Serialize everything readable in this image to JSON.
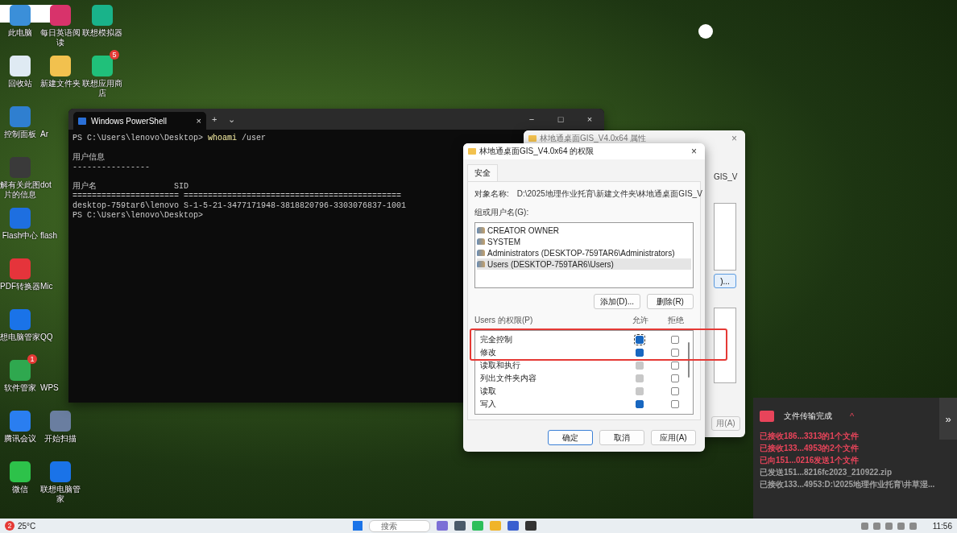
{
  "desktop_icons": [
    {
      "label": "此电脑",
      "kind": "app"
    },
    {
      "label": "回收站",
      "kind": "app"
    },
    {
      "label": "控制面板",
      "kind": "app"
    },
    {
      "label": "解有关此图片的信息",
      "kind": "app"
    },
    {
      "label": "Flash中心",
      "kind": "app"
    },
    {
      "label": "PDF转换器",
      "kind": "app"
    },
    {
      "label": "想电脑管家",
      "kind": "app"
    },
    {
      "label": "软件管家",
      "kind": "app",
      "badge": "1"
    },
    {
      "label": "腾讯会议",
      "kind": "app"
    },
    {
      "label": "微信",
      "kind": "app"
    },
    {
      "label": "每日英语阅读",
      "kind": "app"
    },
    {
      "label": "新建文件夹",
      "kind": "app"
    },
    {
      "label": "Ar",
      "kind": "covered"
    },
    {
      "label": "dot",
      "kind": "covered"
    },
    {
      "label": "flash",
      "kind": "covered"
    },
    {
      "label": "Mic",
      "kind": "covered"
    },
    {
      "label": "QQ",
      "kind": "covered"
    },
    {
      "label": "WPS",
      "kind": "covered"
    },
    {
      "label": "开始扫描",
      "kind": "app"
    },
    {
      "label": "联想电脑管家",
      "kind": "app"
    },
    {
      "label": "联想模拟器",
      "kind": "app"
    },
    {
      "label": "联想应用商店",
      "kind": "app",
      "badge": "5"
    }
  ],
  "terminal": {
    "tab_title": "Windows PowerShell",
    "tab_close": "×",
    "new_tab": "+",
    "dropdown": "⌄",
    "controls": [
      "−",
      "□",
      "×"
    ],
    "lines": [
      {
        "kind": "command",
        "prompt": "PS C:\\Users\\lenovo\\Desktop>",
        "command": "whoami",
        "args": "/user"
      },
      {
        "kind": "blank"
      },
      {
        "kind": "text",
        "text": "用户信息"
      },
      {
        "kind": "text",
        "text": "----------------"
      },
      {
        "kind": "blank"
      },
      {
        "kind": "text",
        "text": "用户名                SID"
      },
      {
        "kind": "text",
        "text": "====================== ============================================="
      },
      {
        "kind": "text",
        "text": "desktop-759tar6\\lenovo S-1-5-21-3477171948-3818820796-3303076837-1001"
      },
      {
        "kind": "prompt",
        "prompt": "PS C:\\Users\\lenovo\\Desktop>"
      }
    ]
  },
  "properties_window": {
    "title": "林地通桌面GIS_V4.0x64 属性",
    "close": "×",
    "object_name": "GIS_V",
    "edit_button": ")...",
    "apply_button": "用(A)"
  },
  "permissions_dialog": {
    "title": "林地通桌面GIS_V4.0x64 的权限",
    "close": "×",
    "tab": "安全",
    "object_label": "对象名称:",
    "object_value": "D:\\2025地理作业托育\\新建文件夹\\林地通桌面GIS_V",
    "group_label": "组或用户名(G):",
    "users": [
      {
        "name": "CREATOR OWNER",
        "selected": false
      },
      {
        "name": "SYSTEM",
        "selected": false
      },
      {
        "name": "Administrators (DESKTOP-759TAR6\\Administrators)",
        "selected": false
      },
      {
        "name": "Users (DESKTOP-759TAR6\\Users)",
        "selected": true
      }
    ],
    "add_button": "添加(D)...",
    "remove_button": "删除(R)",
    "perm_label": "Users 的权限(P)",
    "allow_header": "允许",
    "deny_header": "拒绝",
    "rows": [
      {
        "name": "完全控制",
        "allow": {
          "checked": true,
          "disabled": false
        },
        "deny": {
          "checked": false,
          "disabled": false
        }
      },
      {
        "name": "修改",
        "allow": {
          "checked": true,
          "disabled": false
        },
        "deny": {
          "checked": false,
          "disabled": false
        }
      },
      {
        "name": "读取和执行",
        "allow": {
          "checked": true,
          "disabled": true
        },
        "deny": {
          "checked": false,
          "disabled": false
        }
      },
      {
        "name": "列出文件夹内容",
        "allow": {
          "checked": true,
          "disabled": true
        },
        "deny": {
          "checked": false,
          "disabled": false
        }
      },
      {
        "name": "读取",
        "allow": {
          "checked": true,
          "disabled": true
        },
        "deny": {
          "checked": false,
          "disabled": false
        }
      },
      {
        "name": "写入",
        "allow": {
          "checked": true,
          "disabled": false
        },
        "deny": {
          "checked": false,
          "disabled": false
        }
      }
    ],
    "buttons": [
      "确定",
      "取消",
      "应用(A)"
    ]
  },
  "notification": {
    "title": "文件传输完成",
    "caret": "^",
    "expand": "»",
    "items": [
      {
        "text": "已接收186...3313的1个文件",
        "color": "#e8445a"
      },
      {
        "text": "已接收133...4953的2个文件",
        "color": "#e8445a"
      },
      {
        "text": "已向151...0216发送1个文件",
        "color": "#e8445a"
      },
      {
        "text": "已发送151...8216fc2023_210922.zip",
        "color": "#a0a0a0"
      },
      {
        "text": "已接收133...4953:D:\\2025地理作业托育\\井草湿...",
        "color": "#a0a0a0"
      }
    ]
  },
  "taskbar": {
    "weather_badge": "2",
    "temperature": "25°C",
    "search_placeholder": "搜索",
    "time": "11:56"
  }
}
